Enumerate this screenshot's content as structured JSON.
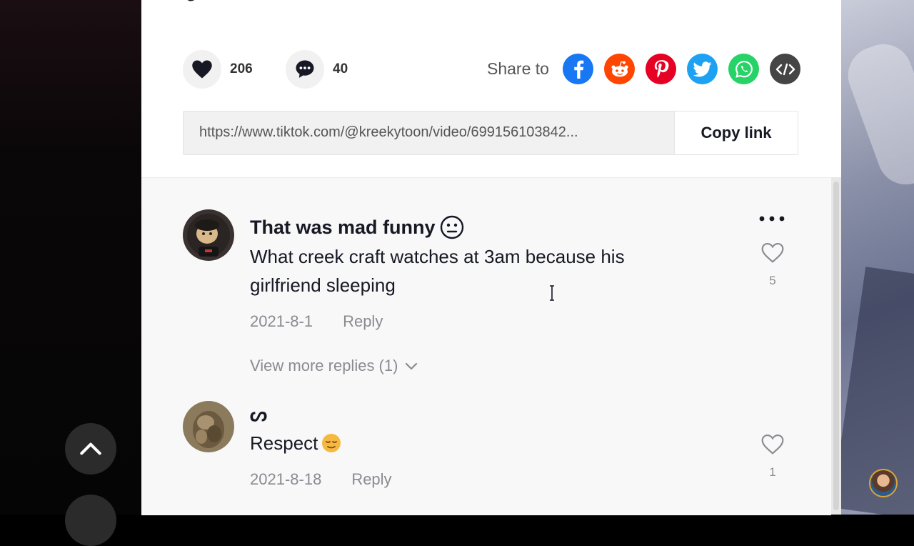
{
  "post": {
    "likes": "206",
    "comments": "40",
    "share_label": "Share to",
    "share_targets": [
      "facebook-icon",
      "reddit-icon",
      "pinterest-icon",
      "twitter-icon",
      "whatsapp-icon",
      "embed-icon"
    ],
    "link_url": "https://www.tiktok.com/@kreekytoon/video/699156103842...",
    "copy_label": "Copy link"
  },
  "comments": [
    {
      "name": "That was mad funny",
      "name_emoji": "😐",
      "text": "What creek craft watches at 3am because his girlfriend sleeping",
      "date": "2021-8-1",
      "reply_label": "Reply",
      "likes": "5",
      "view_more": "View more replies (1)"
    },
    {
      "name": "ᔕ",
      "text": "Respect",
      "text_emoji": "😌",
      "date": "2021-8-18",
      "reply_label": "Reply",
      "likes": "1"
    }
  ],
  "colors": {
    "facebook": "#1877f2",
    "reddit": "#ff4500",
    "pinterest": "#e60023",
    "twitter": "#1da1f2",
    "whatsapp": "#25d366",
    "embed": "#454545",
    "emoji_yellow": "#f5b942"
  }
}
